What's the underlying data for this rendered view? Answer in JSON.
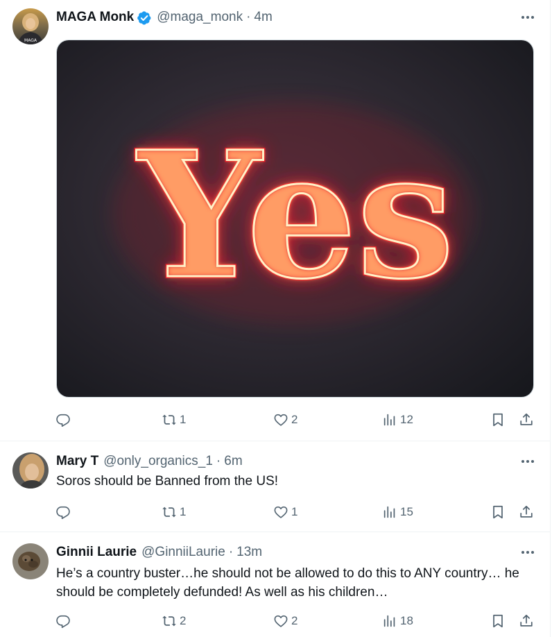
{
  "tweets": [
    {
      "name": "MAGA Monk",
      "handle": "@maga_monk",
      "separator": "·",
      "time": "4m",
      "avatar_badge": "MAGA",
      "media_text": "Yes",
      "stats": {
        "retweets": "1",
        "likes": "2",
        "views": "12"
      }
    },
    {
      "name": "Mary T",
      "handle": "@only_organics_1",
      "separator": "·",
      "time": "6m",
      "text": "Soros should be Banned from the US!",
      "stats": {
        "retweets": "1",
        "likes": "1",
        "views": "15"
      }
    },
    {
      "name": "Ginnii Laurie",
      "handle": "@GinniiLaurie",
      "separator": "·",
      "time": "13m",
      "text": "He’s a country buster…he should not be allowed to do this to ANY country… he should be completely defunded!  As well as his children…",
      "stats": {
        "retweets": "2",
        "likes": "2",
        "views": "18"
      }
    }
  ],
  "icons": {
    "verified": "verified-badge-icon",
    "more": "more-options-icon",
    "reply": "reply-icon",
    "retweet": "retweet-icon",
    "like": "like-icon",
    "views": "views-icon",
    "bookmark": "bookmark-icon",
    "share": "share-icon"
  },
  "colors": {
    "text": "#0f1419",
    "secondary": "#536471",
    "verified": "#1d9bf0",
    "neon_red": "#ff2a2a",
    "neon_core": "#ffd98a"
  }
}
